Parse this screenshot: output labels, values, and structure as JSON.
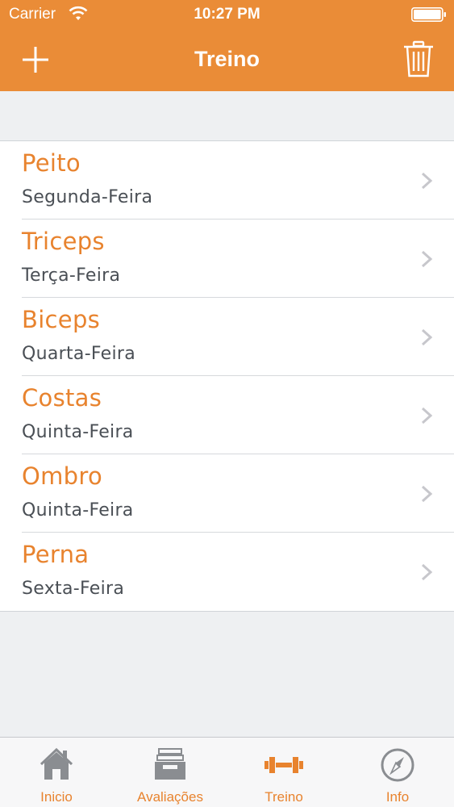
{
  "status_bar": {
    "carrier": "Carrier",
    "time": "10:27 PM"
  },
  "nav": {
    "title": "Treino",
    "add_icon": "plus-icon",
    "trash_icon": "trash-icon"
  },
  "workouts": [
    {
      "title": "Peito",
      "day": "Segunda-Feira"
    },
    {
      "title": "Triceps",
      "day": "Terça-Feira"
    },
    {
      "title": "Biceps",
      "day": "Quarta-Feira"
    },
    {
      "title": "Costas",
      "day": "Quinta-Feira"
    },
    {
      "title": "Ombro",
      "day": "Quinta-Feira"
    },
    {
      "title": "Perna",
      "day": "Sexta-Feira"
    }
  ],
  "tab_bar": {
    "selected": "Treino",
    "tabs": [
      {
        "label": "Inicio",
        "icon": "home-icon"
      },
      {
        "label": "Avaliações",
        "icon": "inbox-tray-icon"
      },
      {
        "label": "Treino",
        "icon": "dumbbell-icon"
      },
      {
        "label": "Info",
        "icon": "compass-icon"
      }
    ]
  },
  "colors": {
    "accent": "#ea8c37",
    "title_text": "#e8832e",
    "subtitle_text": "#4a4f55",
    "background": "#eef0f2",
    "tab_inactive": "#8a8d91"
  }
}
